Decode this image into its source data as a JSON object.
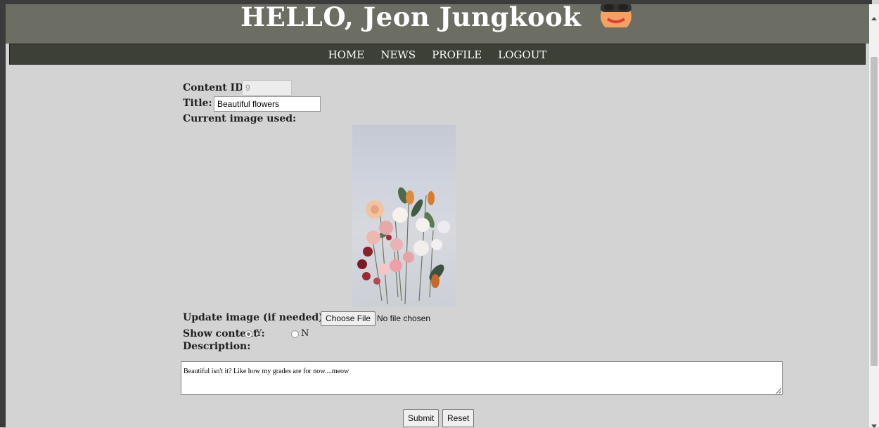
{
  "header": {
    "title": "HELLO, Jeon Jungkook"
  },
  "nav": {
    "items": [
      "HOME",
      "NEWS",
      "PROFILE",
      "LOGOUT"
    ]
  },
  "form": {
    "content_id_label": "Content ID:",
    "content_id_value": "9",
    "title_label": "Title:",
    "title_value": "Beautiful flowers",
    "current_image_label": "Current image used:",
    "update_image_label": "Update image (if needed):",
    "choose_file_label": "Choose File",
    "no_file_text": "No file chosen",
    "show_content_label": "Show content :",
    "show_options": [
      "Y",
      "N"
    ],
    "show_selected": "Y",
    "description_label": "Description:",
    "description_value": "Beautiful isn't it? Like how my grades are for now....meow",
    "submit_label": "Submit",
    "reset_label": "Reset"
  },
  "colors": {
    "header_bg": "#6c6e64",
    "nav_bg": "#3c4036",
    "page_bg": "#d3d3d3"
  }
}
